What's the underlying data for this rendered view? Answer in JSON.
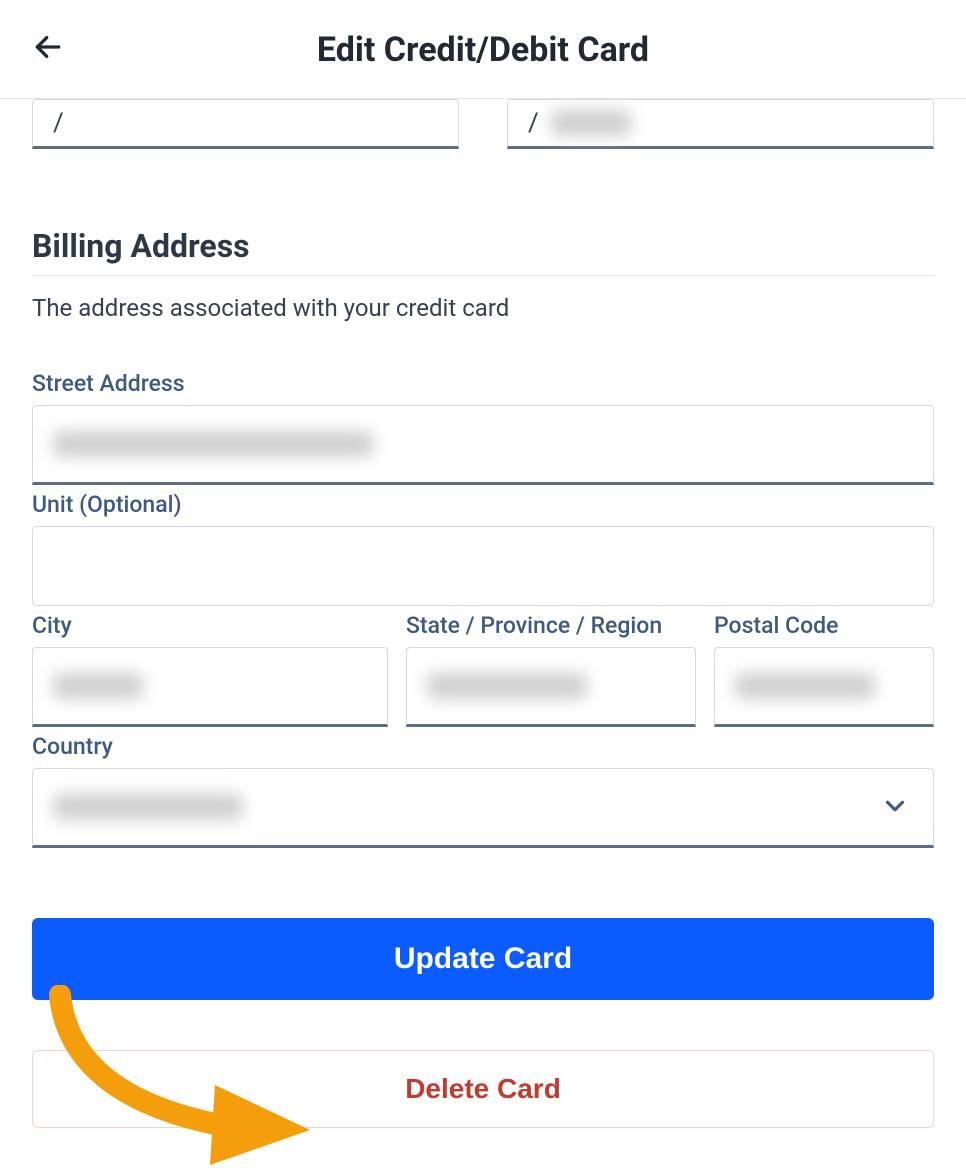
{
  "header": {
    "title": "Edit Credit/Debit Card"
  },
  "card_fields": {
    "expiry_separator": "/",
    "cvv_separator": "/"
  },
  "billing": {
    "section_title": "Billing Address",
    "section_subtitle": "The address associated with your credit card",
    "street_label": "Street Address",
    "unit_label": "Unit (Optional)",
    "city_label": "City",
    "state_label": "State / Province / Region",
    "postal_label": "Postal Code",
    "country_label": "Country"
  },
  "buttons": {
    "update": "Update Card",
    "delete": "Delete Card"
  }
}
